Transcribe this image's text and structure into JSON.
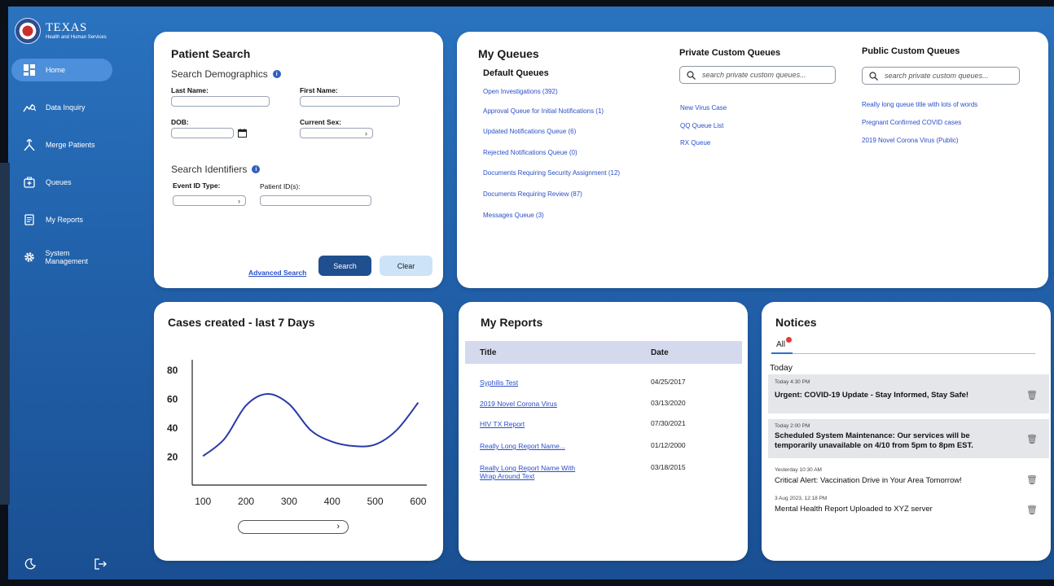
{
  "brand": {
    "line1": "TEXAS",
    "line2": "Health and Human Services"
  },
  "sidebar": {
    "items": [
      {
        "label": "Home",
        "icon": "dashboard-icon",
        "active": true
      },
      {
        "label": "Data Inquiry",
        "icon": "trend-search-icon"
      },
      {
        "label": "Merge Patients",
        "icon": "merge-icon"
      },
      {
        "label": "Queues",
        "icon": "plus-box-icon"
      },
      {
        "label": "My Reports",
        "icon": "report-icon"
      },
      {
        "label": "System Management",
        "icon": "gear-icon"
      }
    ],
    "bottom": {
      "theme_icon": "moon-icon",
      "logout_icon": "logout-icon"
    }
  },
  "patient_search": {
    "title": "Patient Search",
    "demographics_label": "Search Demographics",
    "last_name_label": "Last Name:",
    "first_name_label": "First Name:",
    "dob_label": "DOB:",
    "sex_label": "Current Sex:",
    "identifiers_label": "Search Identifiers",
    "event_id_label": "Event ID Type:",
    "patient_id_label": "Patient ID(s):",
    "advanced_search": "Advanced Search",
    "search_button": "Search",
    "clear_button": "Clear"
  },
  "my_queues": {
    "title": "My Queues",
    "default_title": "Default Queues",
    "default_items": [
      "Open Investigations (392)",
      "Approval Queue for Initial Notifications (1)",
      "Updated Notifications Queue (6)",
      "Rejected Notifications Queue (0)",
      "Documents Requiring Security Assignment (12)",
      "Documents Requiring Review (87)",
      "Messages Queue (3)"
    ],
    "private_title": "Private Custom Queues",
    "private_placeholder": "search private custom queues...",
    "private_items": [
      "New Virus Case",
      "QQ Queue List",
      "RX Queue"
    ],
    "public_title": "Public Custom Queues",
    "public_placeholder": "search private custom queues...",
    "public_items": [
      "Really long queue title with lots of words",
      "Pregnant Confirmed COVID cases",
      "2019 Novel Corona Virus (Public)"
    ]
  },
  "chart": {
    "title": "Cases created - last 7 Days"
  },
  "chart_data": {
    "type": "line",
    "title": "Cases created - last 7 Days",
    "x": [
      100,
      150,
      200,
      250,
      300,
      350,
      400,
      450,
      500,
      550,
      600
    ],
    "y": [
      20,
      32,
      55,
      63,
      56,
      38,
      30,
      27,
      28,
      38,
      57
    ],
    "xticks": [
      100,
      200,
      300,
      400,
      500,
      600
    ],
    "yticks": [
      20,
      40,
      60,
      80
    ],
    "xlim": [
      75,
      620
    ],
    "ylim": [
      0,
      90
    ],
    "grid": false
  },
  "my_reports": {
    "title": "My Reports",
    "col_title": "Title",
    "col_date": "Date",
    "rows": [
      {
        "title": "Syphilis Test",
        "date": "04/25/2017"
      },
      {
        "title": "2019 Novel Corona Virus",
        "date": "03/13/2020"
      },
      {
        "title": "HIV TX Report",
        "date": "07/30/2021"
      },
      {
        "title": "Really Long Report Name...",
        "date": "01/12/2000"
      },
      {
        "title": "Really Long Report Name With Wrap Around Text",
        "date": "03/18/2015"
      }
    ]
  },
  "notices": {
    "title": "Notices",
    "tab_all": "All",
    "section": "Today",
    "items": [
      {
        "time": "Today 4:30 PM",
        "text": "Urgent: COVID-19 Update - Stay Informed, Stay Safe!",
        "bold": true,
        "highlight": true
      },
      {
        "time": "Today 2:00 PM",
        "text": "Scheduled System Maintenance: Our services will be temporarily unavailable on 4/10 from 5pm to 8pm EST.",
        "bold": true,
        "highlight": true
      },
      {
        "time": "Yesterday 10:30 AM",
        "text": "Critical Alert: Vaccination Drive in Your Area Tomorrow!",
        "bold": false,
        "highlight": false
      },
      {
        "time": "3 Aug 2023, 12:18 PM",
        "text": "Mental Health Report Uploaded to XYZ server",
        "bold": false,
        "highlight": false
      }
    ]
  },
  "colors": {
    "accent": "#1f4f8f",
    "link": "#2b4fc7",
    "clear_button": "#cde3f7",
    "notification_dot": "#e53935"
  }
}
